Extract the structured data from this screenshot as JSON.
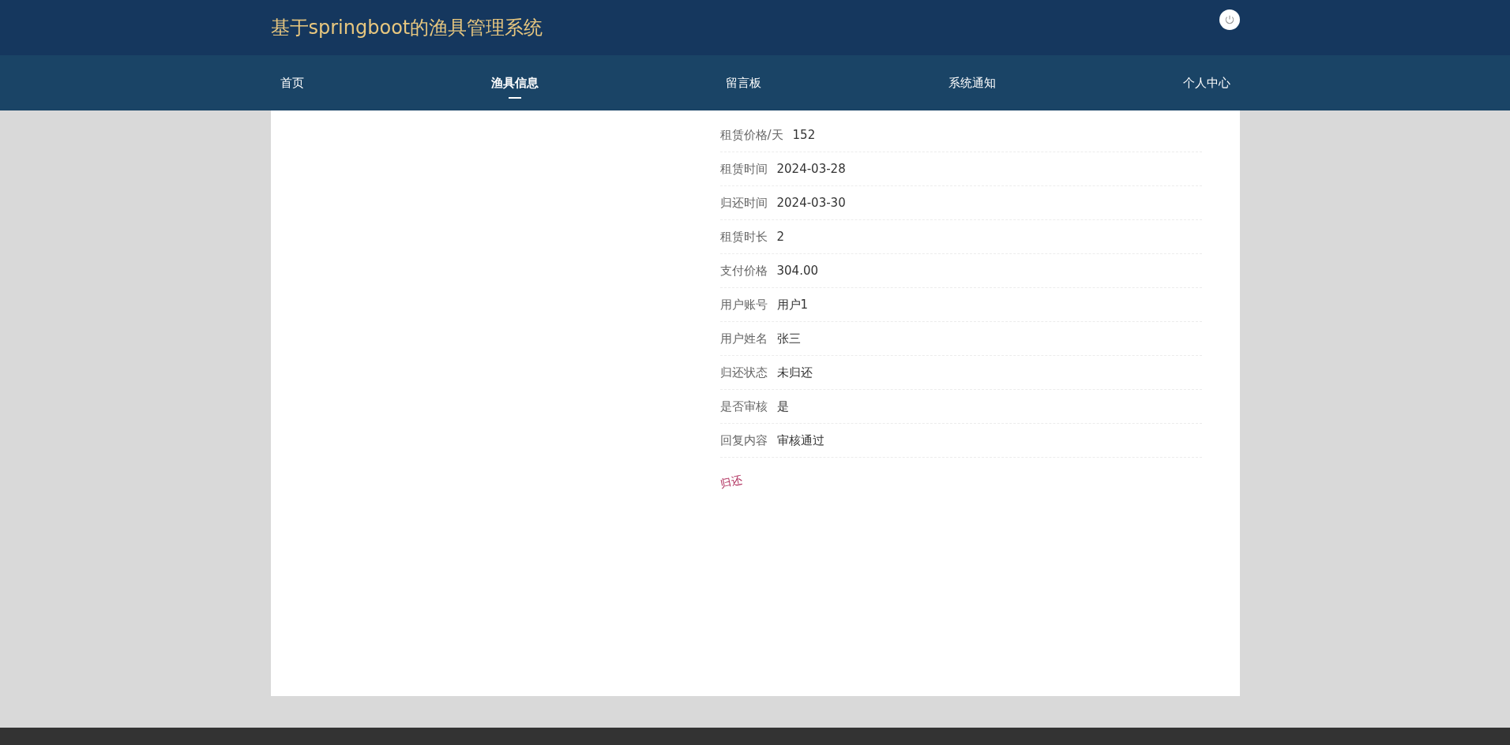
{
  "header": {
    "title": "基于springboot的渔具管理系统"
  },
  "nav": [
    {
      "label": "首页",
      "selected": false
    },
    {
      "label": "渔具信息",
      "selected": true
    },
    {
      "label": "留言板",
      "selected": false
    },
    {
      "label": "系统通知",
      "selected": false
    },
    {
      "label": "个人中心",
      "selected": false
    }
  ],
  "details": [
    {
      "label": "租赁价格/天",
      "value": "152"
    },
    {
      "label": "租赁时间",
      "value": "2024-03-28"
    },
    {
      "label": "归还时间",
      "value": "2024-03-30"
    },
    {
      "label": "租赁时长",
      "value": "2"
    },
    {
      "label": "支付价格",
      "value": "304.00"
    },
    {
      "label": "用户账号",
      "value": "用户1"
    },
    {
      "label": "用户姓名",
      "value": "张三"
    },
    {
      "label": "归还状态",
      "value": "未归还"
    },
    {
      "label": "是否审核",
      "value": "是"
    },
    {
      "label": "回复内容",
      "value": "审核通过"
    }
  ],
  "action_link": "归还"
}
